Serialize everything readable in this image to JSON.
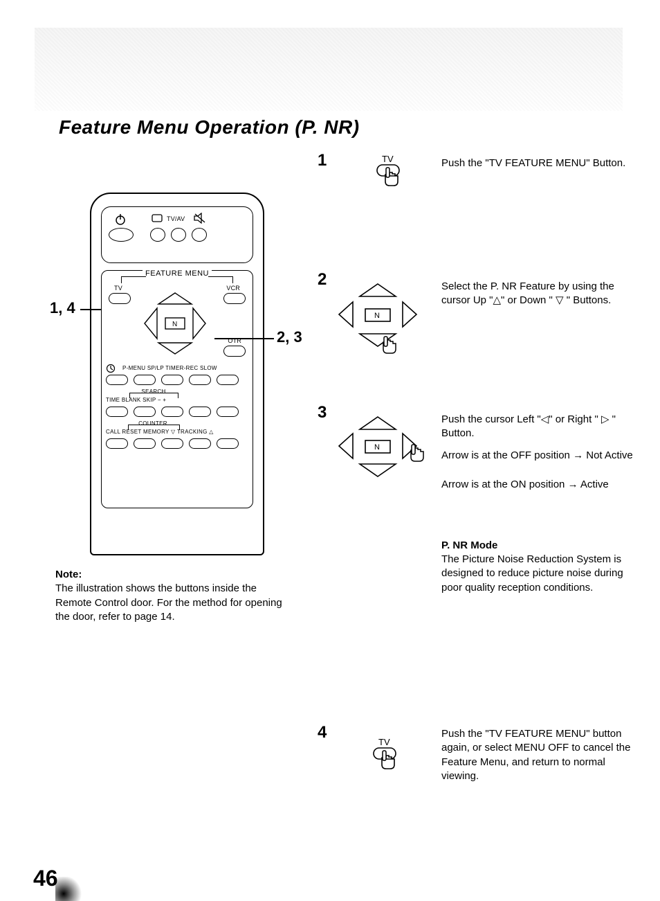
{
  "page_number": "46",
  "title": "Feature Menu Operation (P. NR)",
  "callouts": {
    "left_1_4": "1, 4",
    "right_2_3": "2, 3"
  },
  "steps": {
    "s1": {
      "num": "1",
      "text": "Push the \"TV FEATURE MENU\" Button."
    },
    "s2": {
      "num": "2",
      "text": "Select the P. NR Feature by using the cursor Up \"△\" or Down \" ▽ \" Buttons."
    },
    "s3": {
      "num": "3",
      "line1": "Push the cursor Left \"◁\" or Right \" ▷ \" Button.",
      "line2": "Arrow is at the OFF position → Not Active",
      "line3": "Arrow is at the ON position → Active"
    },
    "s4": {
      "num": "4",
      "text": "Push the \"TV FEATURE MENU\" button again, or select MENU OFF to cancel the Feature Menu, and return to normal viewing."
    }
  },
  "pnr": {
    "heading": "P. NR Mode",
    "text": "The Picture Noise Reduction System is designed to reduce picture noise during poor quality reception conditions."
  },
  "note": {
    "label": "Note:",
    "text": "The illustration shows the buttons inside the Remote Control door. For the method for opening the door, refer to page 14."
  },
  "remote": {
    "top": {
      "tv_av": "TV/AV"
    },
    "feature_menu_title": "FEATURE MENU",
    "tv_lbl": "TV",
    "vcr_lbl": "VCR",
    "n_lbl": "N",
    "otr_lbl": "OTR",
    "row2": "P-MENU   SP/LP TIMER-REC SLOW",
    "row3_top": "SEARCH",
    "row3": "TIME    BLANK    SKIP     −         +",
    "row4_top": "COUNTER",
    "row4": "CALL   RESET  MEMORY   ▽ TRACKING △"
  },
  "icon_labels": {
    "tv": "TV",
    "n": "N"
  }
}
